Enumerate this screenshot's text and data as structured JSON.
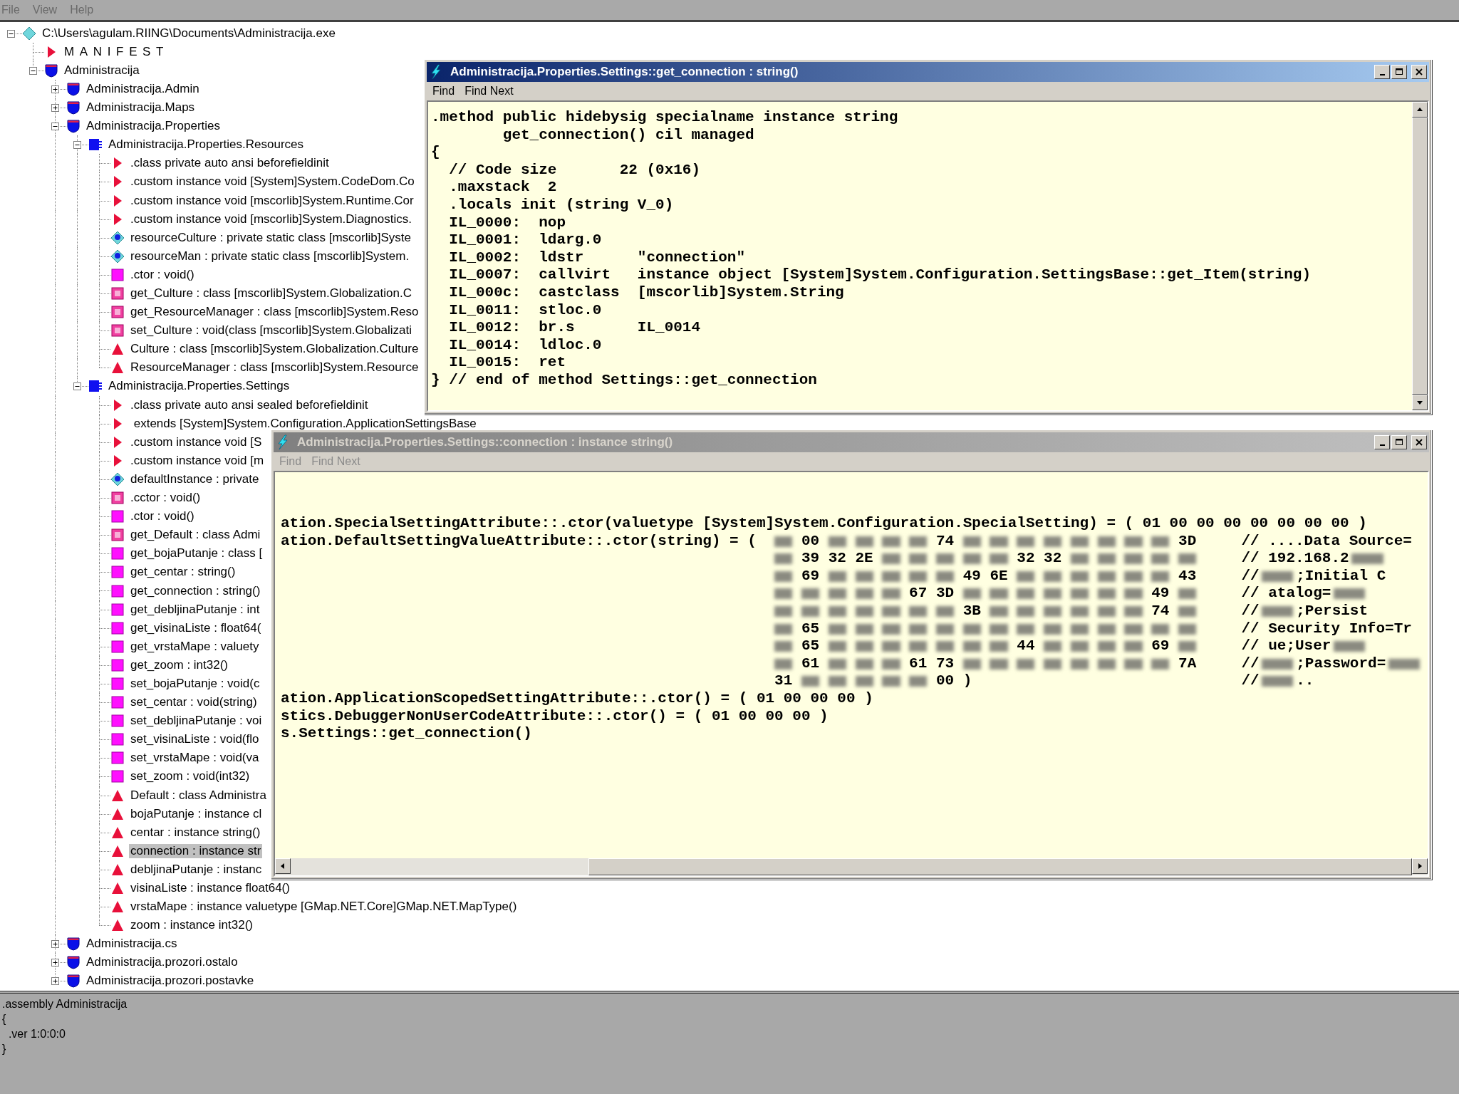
{
  "menu_bar": [
    "File",
    "View",
    "Help"
  ],
  "tree": {
    "items": [
      {
        "kind": "exe",
        "text": "C:\\Users\\agulam.RIING\\Documents\\Administracija.exe",
        "expanded": true,
        "selected": false,
        "children": [
          {
            "kind": "manifest",
            "text": "MANIFEST",
            "selected": false
          },
          {
            "kind": "namespace",
            "text": "Administracija",
            "expanded": true,
            "selected": false,
            "children": [
              {
                "kind": "namespace",
                "text": "Administracija.Admin",
                "expanded": false,
                "selected": false
              },
              {
                "kind": "namespace",
                "text": "Administracija.Maps",
                "expanded": false,
                "selected": false
              },
              {
                "kind": "namespace",
                "text": "Administracija.Properties",
                "expanded": true,
                "selected": false,
                "children": [
                  {
                    "kind": "class",
                    "text": "Administracija.Properties.Resources",
                    "expanded": true,
                    "selected": false,
                    "children": [
                      {
                        "kind": "meta",
                        "text": ".class private auto ansi beforefieldinit",
                        "selected": false
                      },
                      {
                        "kind": "meta",
                        "text": ".custom instance void [System]System.CodeDom.Co",
                        "selected": false
                      },
                      {
                        "kind": "meta",
                        "text": ".custom instance void [mscorlib]System.Runtime.Cor",
                        "selected": false
                      },
                      {
                        "kind": "meta",
                        "text": ".custom instance void [mscorlib]System.Diagnostics.",
                        "selected": false
                      },
                      {
                        "kind": "static_field",
                        "text": "resourceCulture : private static class [mscorlib]Syste",
                        "selected": false
                      },
                      {
                        "kind": "static_field",
                        "text": "resourceMan : private static class [mscorlib]System.",
                        "selected": false
                      },
                      {
                        "kind": "method",
                        "text": ".ctor : void()",
                        "selected": false
                      },
                      {
                        "kind": "static_method",
                        "text": "get_Culture : class [mscorlib]System.Globalization.C",
                        "selected": false
                      },
                      {
                        "kind": "static_method",
                        "text": "get_ResourceManager : class [mscorlib]System.Reso",
                        "selected": false
                      },
                      {
                        "kind": "static_method",
                        "text": "set_Culture : void(class [mscorlib]System.Globalizati",
                        "selected": false
                      },
                      {
                        "kind": "property",
                        "text": "Culture : class [mscorlib]System.Globalization.Culture",
                        "selected": false
                      },
                      {
                        "kind": "property",
                        "text": "ResourceManager : class [mscorlib]System.Resource",
                        "selected": false
                      }
                    ]
                  },
                  {
                    "kind": "class",
                    "text": "Administracija.Properties.Settings",
                    "expanded": true,
                    "selected": false,
                    "children": [
                      {
                        "kind": "meta",
                        "text": ".class private auto ansi sealed beforefieldinit",
                        "selected": false
                      },
                      {
                        "kind": "meta",
                        "text": " extends [System]System.Configuration.ApplicationSettingsBase",
                        "selected": false
                      },
                      {
                        "kind": "meta",
                        "text": ".custom instance void [S",
                        "selected": false
                      },
                      {
                        "kind": "meta",
                        "text": ".custom instance void [m",
                        "selected": false
                      },
                      {
                        "kind": "static_field",
                        "text": "defaultInstance : private",
                        "selected": false
                      },
                      {
                        "kind": "static_method",
                        "text": ".cctor : void()",
                        "selected": false
                      },
                      {
                        "kind": "method",
                        "text": ".ctor : void()",
                        "selected": false
                      },
                      {
                        "kind": "static_method",
                        "text": "get_Default : class Admi",
                        "selected": false
                      },
                      {
                        "kind": "method",
                        "text": "get_bojaPutanje : class [",
                        "selected": false
                      },
                      {
                        "kind": "method",
                        "text": "get_centar : string()",
                        "selected": false
                      },
                      {
                        "kind": "method",
                        "text": "get_connection : string()",
                        "selected": false
                      },
                      {
                        "kind": "method",
                        "text": "get_debljinaPutanje : int",
                        "selected": false
                      },
                      {
                        "kind": "method",
                        "text": "get_visinaListe : float64(",
                        "selected": false
                      },
                      {
                        "kind": "method",
                        "text": "get_vrstaMape : valuety",
                        "selected": false
                      },
                      {
                        "kind": "method",
                        "text": "get_zoom : int32()",
                        "selected": false
                      },
                      {
                        "kind": "method",
                        "text": "set_bojaPutanje : void(c",
                        "selected": false
                      },
                      {
                        "kind": "method",
                        "text": "set_centar : void(string)",
                        "selected": false
                      },
                      {
                        "kind": "method",
                        "text": "set_debljinaPutanje : voi",
                        "selected": false
                      },
                      {
                        "kind": "method",
                        "text": "set_visinaListe : void(flo",
                        "selected": false
                      },
                      {
                        "kind": "method",
                        "text": "set_vrstaMape : void(va",
                        "selected": false
                      },
                      {
                        "kind": "method",
                        "text": "set_zoom : void(int32)",
                        "selected": false
                      },
                      {
                        "kind": "property",
                        "text": "Default : class Administra",
                        "selected": false
                      },
                      {
                        "kind": "property",
                        "text": "bojaPutanje : instance cl",
                        "selected": false
                      },
                      {
                        "kind": "property",
                        "text": "centar : instance string()",
                        "selected": false
                      },
                      {
                        "kind": "property",
                        "text": "connection : instance str",
                        "selected": true
                      },
                      {
                        "kind": "property",
                        "text": "debljinaPutanje : instanc",
                        "selected": false
                      },
                      {
                        "kind": "property",
                        "text": "visinaListe : instance float64()",
                        "selected": false
                      },
                      {
                        "kind": "property",
                        "text": "vrstaMape : instance valuetype [GMap.NET.Core]GMap.NET.MapType()",
                        "selected": false
                      },
                      {
                        "kind": "property",
                        "text": "zoom : instance int32()",
                        "selected": false
                      }
                    ]
                  }
                ]
              },
              {
                "kind": "namespace",
                "text": "Administracija.cs",
                "expanded": false,
                "selected": false
              },
              {
                "kind": "namespace",
                "text": "Administracija.prozori.ostalo",
                "expanded": false,
                "selected": false
              },
              {
                "kind": "namespace",
                "text": "Administracija.prozori.postavke",
                "expanded": false,
                "selected": false
              }
            ]
          }
        ]
      }
    ]
  },
  "info_panel": [
    ".assembly Administracija",
    "{",
    "  .ver 1:0:0:0",
    "}"
  ],
  "code_window": {
    "title": "Administracija.Properties.Settings::get_connection : string()",
    "active": true,
    "menu": [
      "Find",
      "Find Next"
    ],
    "lines": [
      ".method public hidebysig specialname instance string",
      "        get_connection() cil managed",
      "{",
      "  // Code size       22 (0x16)",
      "  .maxstack  2",
      "  .locals init (string V_0)",
      "  IL_0000:  nop",
      "  IL_0001:  ldarg.0",
      "  IL_0002:  ldstr      \"connection\"",
      "  IL_0007:  callvirt   instance object [System]System.Configuration.SettingsBase::get_Item(string)",
      "  IL_000c:  castclass  [mscorlib]System.String",
      "  IL_0011:  stloc.0",
      "  IL_0012:  br.s       IL_0014",
      "  IL_0014:  ldloc.0",
      "  IL_0015:  ret",
      "} // end of method Settings::get_connection"
    ]
  },
  "attribute_window": {
    "title": "Administracija.Properties.Settings::connection : instance string()",
    "active": false,
    "menu": [
      "Find",
      "Find Next"
    ],
    "lines_before": [
      "ation.SpecialSettingAttribute::.ctor(valuetype [System]System.Configuration.SpecialSetting) = ( 01 00 00 00 00 00 00 00 )"
    ],
    "hex_prefix": "ation.DefaultSettingValueAttribute::.ctor(string) = (",
    "hex_rows": [
      {
        "cells": [
          {
            "kind": "blur"
          },
          "00",
          {
            "kind": "blur"
          },
          {
            "kind": "blur"
          },
          {
            "kind": "blur"
          },
          {
            "kind": "blur"
          },
          "74",
          {
            "kind": "blur"
          },
          {
            "kind": "blur"
          },
          {
            "kind": "blur"
          },
          {
            "kind": "blur"
          },
          {
            "kind": "blur"
          },
          {
            "kind": "blur"
          },
          {
            "kind": "blur"
          },
          {
            "kind": "blur"
          },
          "3D"
        ],
        "comment": [
          "// ....Data Source="
        ]
      },
      {
        "cells": [
          {
            "kind": "blur"
          },
          "39",
          "32",
          "2E",
          {
            "kind": "blur"
          },
          {
            "kind": "blur"
          },
          {
            "kind": "blur"
          },
          {
            "kind": "blur"
          },
          {
            "kind": "blur"
          },
          "32",
          "32",
          {
            "kind": "blur"
          },
          {
            "kind": "blur"
          },
          {
            "kind": "blur"
          },
          {
            "kind": "blur"
          },
          {
            "kind": "blur"
          }
        ],
        "comment": [
          "// 192.168.2",
          {
            "kind": "blur"
          }
        ]
      },
      {
        "cells": [
          {
            "kind": "blur"
          },
          "69",
          {
            "kind": "blur"
          },
          {
            "kind": "blur"
          },
          {
            "kind": "blur"
          },
          {
            "kind": "blur"
          },
          {
            "kind": "blur"
          },
          "49",
          "6E",
          {
            "kind": "blur"
          },
          {
            "kind": "blur"
          },
          {
            "kind": "blur"
          },
          {
            "kind": "blur"
          },
          {
            "kind": "blur"
          },
          {
            "kind": "blur"
          },
          "43"
        ],
        "comment": [
          "//",
          {
            "kind": "blur"
          },
          ";Initial C"
        ]
      },
      {
        "cells": [
          {
            "kind": "blur"
          },
          {
            "kind": "blur"
          },
          {
            "kind": "blur"
          },
          {
            "kind": "blur"
          },
          {
            "kind": "blur"
          },
          "67",
          "3D",
          {
            "kind": "blur"
          },
          {
            "kind": "blur"
          },
          {
            "kind": "blur"
          },
          {
            "kind": "blur"
          },
          {
            "kind": "blur"
          },
          {
            "kind": "blur"
          },
          {
            "kind": "blur"
          },
          "49",
          {
            "kind": "blur"
          }
        ],
        "comment": [
          "// atalog=",
          {
            "kind": "blur"
          }
        ]
      },
      {
        "cells": [
          {
            "kind": "blur"
          },
          {
            "kind": "blur"
          },
          {
            "kind": "blur"
          },
          {
            "kind": "blur"
          },
          {
            "kind": "blur"
          },
          {
            "kind": "blur"
          },
          {
            "kind": "blur"
          },
          "3B",
          {
            "kind": "blur"
          },
          {
            "kind": "blur"
          },
          {
            "kind": "blur"
          },
          {
            "kind": "blur"
          },
          {
            "kind": "blur"
          },
          {
            "kind": "blur"
          },
          "74",
          {
            "kind": "blur"
          }
        ],
        "comment": [
          "//",
          {
            "kind": "blur"
          },
          ";Persist"
        ]
      },
      {
        "cells": [
          {
            "kind": "blur"
          },
          "65",
          {
            "kind": "blur"
          },
          {
            "kind": "blur"
          },
          {
            "kind": "blur"
          },
          {
            "kind": "blur"
          },
          {
            "kind": "blur"
          },
          {
            "kind": "blur"
          },
          {
            "kind": "blur"
          },
          {
            "kind": "blur"
          },
          {
            "kind": "blur"
          },
          {
            "kind": "blur"
          },
          {
            "kind": "blur"
          },
          {
            "kind": "blur"
          },
          {
            "kind": "blur"
          },
          {
            "kind": "blur"
          }
        ],
        "comment": [
          "// Security Info=Tr"
        ]
      },
      {
        "cells": [
          {
            "kind": "blur"
          },
          "65",
          {
            "kind": "blur"
          },
          {
            "kind": "blur"
          },
          {
            "kind": "blur"
          },
          {
            "kind": "blur"
          },
          {
            "kind": "blur"
          },
          {
            "kind": "blur"
          },
          {
            "kind": "blur"
          },
          "44",
          {
            "kind": "blur"
          },
          {
            "kind": "blur"
          },
          {
            "kind": "blur"
          },
          {
            "kind": "blur"
          },
          "69",
          {
            "kind": "blur"
          }
        ],
        "comment": [
          "// ue;User",
          {
            "kind": "blur"
          }
        ]
      },
      {
        "cells": [
          {
            "kind": "blur"
          },
          "61",
          {
            "kind": "blur"
          },
          {
            "kind": "blur"
          },
          {
            "kind": "blur"
          },
          "61",
          "73",
          {
            "kind": "blur"
          },
          {
            "kind": "blur"
          },
          {
            "kind": "blur"
          },
          {
            "kind": "blur"
          },
          {
            "kind": "blur"
          },
          {
            "kind": "blur"
          },
          {
            "kind": "blur"
          },
          {
            "kind": "blur"
          },
          "7A"
        ],
        "comment": [
          "//",
          {
            "kind": "blur"
          },
          ";Password=",
          {
            "kind": "blur"
          }
        ]
      },
      {
        "cells": [
          "31",
          {
            "kind": "blur"
          },
          {
            "kind": "blur"
          },
          {
            "kind": "blur"
          },
          {
            "kind": "blur"
          },
          {
            "kind": "blur"
          },
          "00"
        ],
        "close": ")",
        "comment": [
          "//",
          {
            "kind": "blur"
          },
          ".."
        ]
      }
    ],
    "lines_after": [
      "ation.ApplicationScopedSettingAttribute::.ctor() = ( 01 00 00 00 )",
      "stics.DebuggerNonUserCodeAttribute::.ctor() = ( 01 00 00 00 )",
      "s.Settings::get_connection()"
    ]
  }
}
